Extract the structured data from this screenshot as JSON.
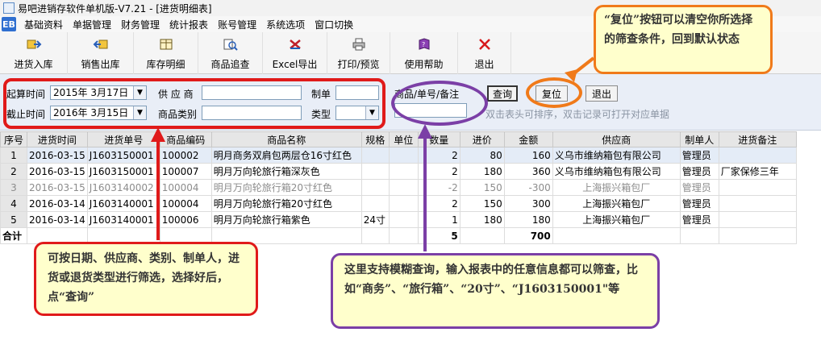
{
  "window": {
    "title": "易吧进销存软件单机版-V7.21 - [进货明细表]"
  },
  "menu": {
    "logo_text": "EB",
    "items": [
      "基础资料",
      "单据管理",
      "财务管理",
      "统计报表",
      "账号管理",
      "系统选项",
      "窗口切换"
    ]
  },
  "toolbar": {
    "buttons": [
      {
        "label": "进货入库",
        "icon": "stock-in-icon"
      },
      {
        "label": "销售出库",
        "icon": "stock-out-icon"
      },
      {
        "label": "库存明细",
        "icon": "inventory-icon"
      },
      {
        "label": "商品追查",
        "icon": "product-trace-icon"
      },
      {
        "label": "Excel导出",
        "icon": "excel-export-icon"
      },
      {
        "label": "打印/预览",
        "icon": "printer-icon"
      },
      {
        "label": "使用帮助",
        "icon": "help-book-icon"
      },
      {
        "label": "退出",
        "icon": "close-icon"
      }
    ]
  },
  "filter": {
    "start_label": "起算时间",
    "start_value": "2015年 3月17日",
    "end_label": "截止时间",
    "end_value": "2016年 3月15日",
    "supplier_label": "供 应 商",
    "supplier_value": "",
    "category_label": "商品类别",
    "category_value": "",
    "creator_label": "制单",
    "creator_value": "",
    "type_label": "类型",
    "type_value": "",
    "keyword_label": "商品/单号/备注",
    "keyword_value": "",
    "query_label": "查询",
    "reset_label": "复位",
    "exit_label": "退出",
    "hint": "双击表头可排序，双击记录可打开对应单据"
  },
  "table": {
    "headers": [
      "序号",
      "进货时间",
      "进货单号",
      "商品编码",
      "商品名称",
      "规格",
      "单位",
      "数量",
      "进价",
      "金额",
      "供应商",
      "制单人",
      "进货备注"
    ],
    "rows": [
      [
        "1",
        "2016-03-15",
        "J1603150001",
        "100002",
        "明月商务双肩包两层仓16寸红色",
        "",
        "",
        "2",
        "80",
        "160",
        "义乌市维纳箱包有限公司",
        "管理员",
        ""
      ],
      [
        "2",
        "2016-03-15",
        "J1603150001",
        "100007",
        "明月万向轮旅行箱深灰色",
        "",
        "",
        "2",
        "180",
        "360",
        "义乌市维纳箱包有限公司",
        "管理员",
        "厂家保修三年"
      ],
      [
        "3",
        "2016-03-15",
        "J1603140002",
        "100004",
        "明月万向轮旅行箱20寸红色",
        "",
        "",
        "-2",
        "150",
        "-300",
        "上海振兴箱包厂",
        "管理员",
        ""
      ],
      [
        "4",
        "2016-03-14",
        "J1603140001",
        "100004",
        "明月万向轮旅行箱20寸红色",
        "",
        "",
        "2",
        "150",
        "300",
        "上海振兴箱包厂",
        "管理员",
        ""
      ],
      [
        "5",
        "2016-03-14",
        "J1603140001",
        "100006",
        "明月万向轮旅行箱紫色",
        "24寸",
        "",
        "1",
        "180",
        "180",
        "上海振兴箱包厂",
        "管理员",
        ""
      ]
    ],
    "total_label": "合计",
    "total_qty": "5",
    "total_amount": "700"
  },
  "callouts": {
    "reset_tip": "“复位”按钮可以清空你所选择的筛查条件，回到默认状态",
    "filter_tip": "可按日期、供应商、类别、制单人，进货或退货类型进行筛选，选择好后，点“查询”",
    "fuzzy_tip": "这里支持模糊查询，输入报表中的任意信息都可以筛查，比如“商务”、“旅行箱”、“20寸”、“J1603150001\"等"
  },
  "colors": {
    "red_highlight": "#e01a1a",
    "orange_highlight": "#f07a1a",
    "purple_highlight": "#7b3fa6",
    "callout_fill": "#ffffcc"
  }
}
